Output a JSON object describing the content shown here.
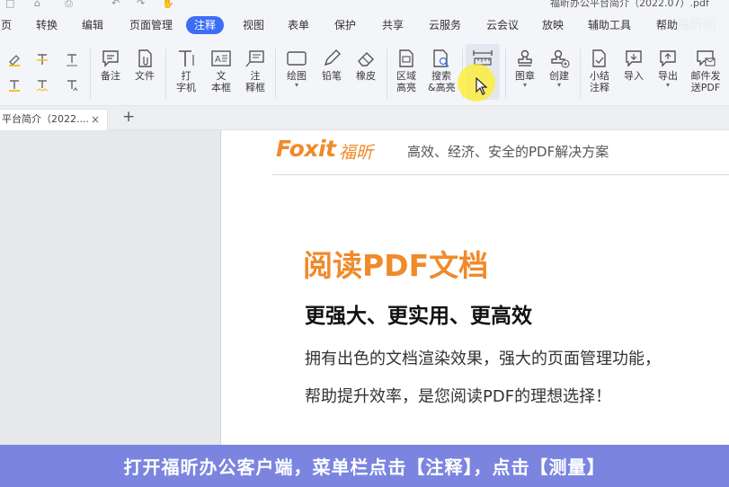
{
  "window": {
    "title": "福昕办公平台简介（2022.07）.pdf",
    "quick_access": [
      "□",
      "⌂",
      "⎙",
      "↶",
      "↷",
      "✋"
    ]
  },
  "menubar": {
    "items": [
      {
        "label": "页",
        "active": false
      },
      {
        "label": "转换",
        "active": false
      },
      {
        "label": "编辑",
        "active": false
      },
      {
        "label": "页面管理",
        "active": false
      },
      {
        "label": "注释",
        "active": true
      },
      {
        "label": "视图",
        "active": false
      },
      {
        "label": "表单",
        "active": false
      },
      {
        "label": "保护",
        "active": false
      },
      {
        "label": "共享",
        "active": false
      },
      {
        "label": "云服务",
        "active": false
      },
      {
        "label": "云会议",
        "active": false
      },
      {
        "label": "放映",
        "active": false
      },
      {
        "label": "辅助工具",
        "active": false
      },
      {
        "label": "帮助",
        "active": false
      }
    ],
    "watermark": "福昕阅"
  },
  "ribbon": {
    "note": "备注",
    "file": "文件",
    "typewriter_1": "打",
    "typewriter_2": "字机",
    "textbox_1": "文",
    "textbox_2": "本框",
    "callout_1": "注",
    "callout_2": "释框",
    "drawing": "绘图",
    "pencil": "铅笔",
    "eraser": "橡皮",
    "area_highlight_1": "区域",
    "area_highlight_2": "高亮",
    "search_highlight_1": "搜索",
    "search_highlight_2": "&高亮",
    "stamp": "图章",
    "create": "创建",
    "summary_1": "小结",
    "summary_2": "注释",
    "import": "导入",
    "export": "导出",
    "email_1": "邮件发",
    "email_2": "送PDF"
  },
  "tabs": {
    "doc_tab_label": "平台简介（2022....",
    "close_glyph": "×",
    "new_tab_glyph": "+"
  },
  "page": {
    "logo_text": "Foxit",
    "logo_cn": "福昕",
    "slogan": "高效、经济、安全的PDF解决方案",
    "title": "阅读PDF文档",
    "subtitle": "更强大、更实用、更高效",
    "desc_line1": "拥有出色的文档渲染效果，强大的页面管理功能，",
    "desc_line2": "帮助提升效率，是您阅读PDF的理想选择！"
  },
  "caption": "打开福昕办公客户端，菜单栏点击【注释】，点击【测量】",
  "colors": {
    "accent": "#3b6ef5",
    "brand_orange": "#f08a2a",
    "caption_bg": "#7b85e0"
  }
}
